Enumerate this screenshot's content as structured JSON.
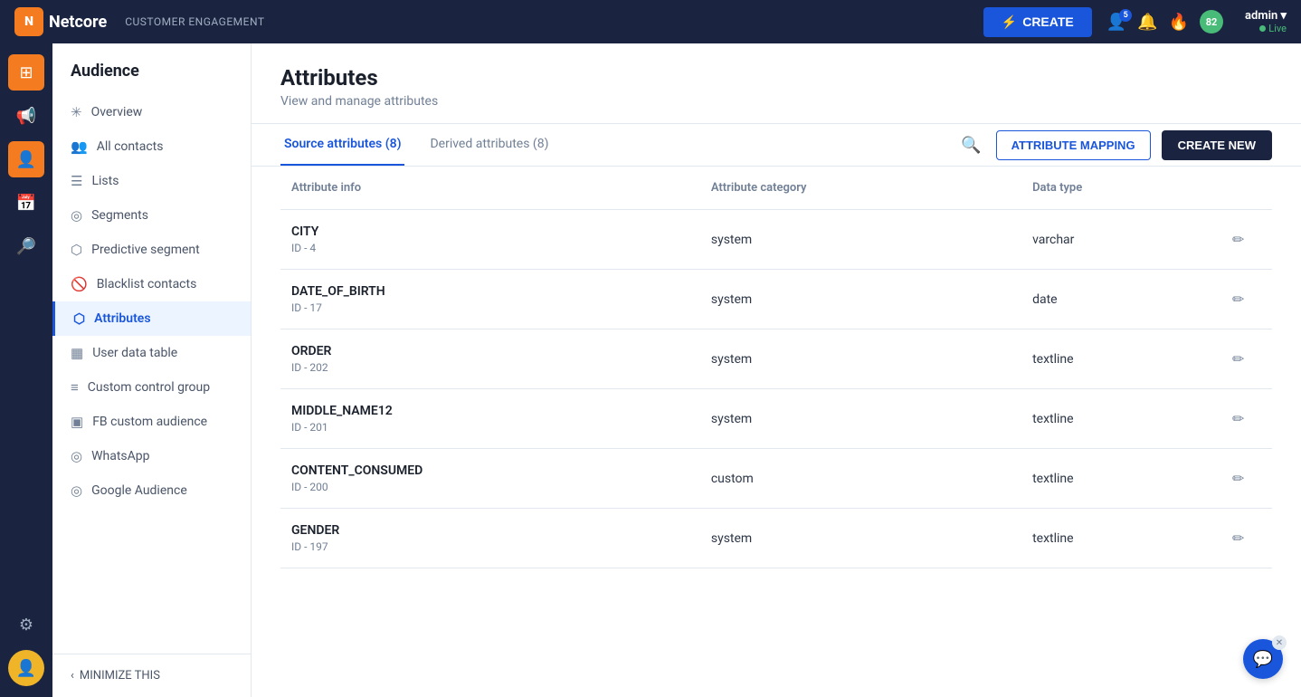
{
  "topnav": {
    "logo_text": "Netcore",
    "product_label": "CUSTOMER ENGAGEMENT",
    "create_btn_label": "CREATE",
    "admin_name": "admin",
    "admin_status": "Live",
    "user_badge": "5",
    "green_badge": "82"
  },
  "sidebar": {
    "title": "Audience",
    "items": [
      {
        "id": "overview",
        "label": "Overview",
        "icon": "✳"
      },
      {
        "id": "all-contacts",
        "label": "All contacts",
        "icon": "👥"
      },
      {
        "id": "lists",
        "label": "Lists",
        "icon": "☰"
      },
      {
        "id": "segments",
        "label": "Segments",
        "icon": "◎"
      },
      {
        "id": "predictive-segment",
        "label": "Predictive segment",
        "icon": "⬡"
      },
      {
        "id": "blacklist-contacts",
        "label": "Blacklist contacts",
        "icon": "🚫"
      },
      {
        "id": "attributes",
        "label": "Attributes",
        "icon": "⬡"
      },
      {
        "id": "user-data-table",
        "label": "User data table",
        "icon": "▦"
      },
      {
        "id": "custom-control-group",
        "label": "Custom control group",
        "icon": "≡"
      },
      {
        "id": "fb-custom-audience",
        "label": "FB custom audience",
        "icon": "▣"
      },
      {
        "id": "whatsapp",
        "label": "WhatsApp",
        "icon": "◎"
      },
      {
        "id": "google-audience",
        "label": "Google Audience",
        "icon": "◎"
      }
    ],
    "minimize_label": "MINIMIZE THIS"
  },
  "page": {
    "title": "Attributes",
    "subtitle": "View and manage attributes",
    "tabs": [
      {
        "id": "source",
        "label": "Source attributes (8)",
        "active": true
      },
      {
        "id": "derived",
        "label": "Derived attributes (8)",
        "active": false
      }
    ],
    "attr_mapping_btn": "ATTRIBUTE MAPPING",
    "create_new_btn": "CREATE NEW",
    "table": {
      "headers": [
        "Attribute info",
        "Attribute category",
        "Data type",
        ""
      ],
      "rows": [
        {
          "name": "CITY",
          "id": "ID - 4",
          "category": "system",
          "data_type": "varchar"
        },
        {
          "name": "DATE_OF_BIRTH",
          "id": "ID - 17",
          "category": "system",
          "data_type": "date"
        },
        {
          "name": "ORDER",
          "id": "ID - 202",
          "category": "system",
          "data_type": "textline"
        },
        {
          "name": "MIDDLE_NAME12",
          "id": "ID - 201",
          "category": "system",
          "data_type": "textline"
        },
        {
          "name": "CONTENT_CONSUMED",
          "id": "ID - 200",
          "category": "custom",
          "data_type": "textline"
        },
        {
          "name": "GENDER",
          "id": "ID - 197",
          "category": "system",
          "data_type": "textline"
        }
      ]
    }
  },
  "rail_items": [
    {
      "id": "grid",
      "icon": "⊞",
      "active": true
    },
    {
      "id": "megaphone",
      "icon": "📢",
      "active": false
    },
    {
      "id": "audience",
      "icon": "👤",
      "active": false
    },
    {
      "id": "calendar",
      "icon": "📅",
      "active": false
    },
    {
      "id": "search-analytics",
      "icon": "🔎",
      "active": false
    }
  ],
  "icons": {
    "create_bolt": "⚡",
    "user_icon": "👤",
    "bell_icon": "🔔",
    "fire_icon": "🔥",
    "chevron_down": "▾",
    "search": "🔍",
    "edit": "✏",
    "minimize_chevron": "‹",
    "chat": "💬",
    "close": "✕"
  }
}
